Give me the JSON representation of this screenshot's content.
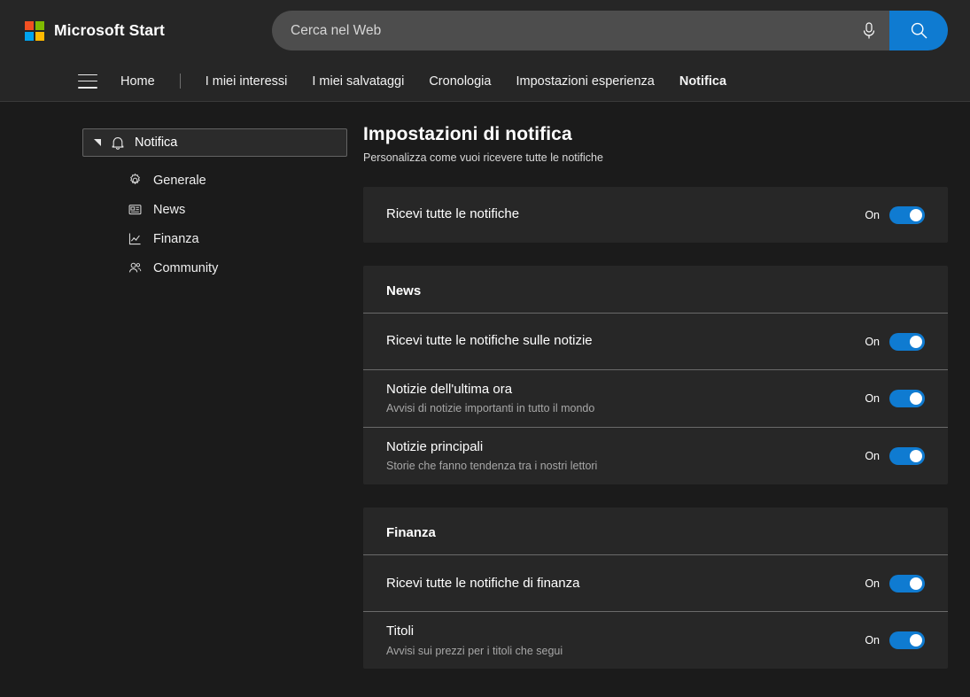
{
  "header": {
    "brand": "Microsoft Start",
    "logo_colors": [
      "#f25022",
      "#7fba00",
      "#00a4ef",
      "#ffb900"
    ],
    "accent": "#0f7bd1",
    "search": {
      "placeholder": "Cerca nel Web",
      "value": "",
      "mic_icon": "microphone-icon",
      "search_icon": "search-icon"
    }
  },
  "nav": {
    "menu_icon": "hamburger-menu-icon",
    "items": [
      {
        "label": "Home",
        "active": false
      },
      {
        "label": "I miei interessi",
        "active": false
      },
      {
        "label": "I miei salvataggi",
        "active": false
      },
      {
        "label": "Cronologia",
        "active": false
      },
      {
        "label": "Impostazioni esperienza",
        "active": false
      },
      {
        "label": "Notifica",
        "active": true
      }
    ]
  },
  "sidebar": {
    "header": {
      "label": "Notifica",
      "icon": "bell-icon",
      "caret": "caret-collapse-icon",
      "expanded": true
    },
    "items": [
      {
        "label": "Generale",
        "icon": "gear-icon"
      },
      {
        "label": "News",
        "icon": "newspaper-icon"
      },
      {
        "label": "Finanza",
        "icon": "line-chart-icon"
      },
      {
        "label": "Community",
        "icon": "people-icon"
      }
    ]
  },
  "main": {
    "title": "Impostazioni di notifica",
    "subtitle": "Personalizza come vuoi ricevere tutte le notifiche",
    "cards": [
      {
        "section": null,
        "rows": [
          {
            "title": "Ricevi tutte le notifiche",
            "desc": null,
            "state": "On",
            "on": true
          }
        ]
      },
      {
        "section": "News",
        "rows": [
          {
            "title": "Ricevi tutte le notifiche sulle notizie",
            "desc": null,
            "state": "On",
            "on": true
          },
          {
            "title": "Notizie dell'ultima ora",
            "desc": "Avvisi di notizie importanti in tutto il mondo",
            "state": "On",
            "on": true
          },
          {
            "title": "Notizie principali",
            "desc": "Storie che fanno tendenza tra i nostri lettori",
            "state": "On",
            "on": true
          }
        ]
      },
      {
        "section": "Finanza",
        "rows": [
          {
            "title": "Ricevi tutte le notifiche di finanza",
            "desc": null,
            "state": "On",
            "on": true
          },
          {
            "title": "Titoli",
            "desc": "Avvisi sui prezzi per i titoli che segui",
            "state": "On",
            "on": true
          }
        ]
      }
    ]
  }
}
